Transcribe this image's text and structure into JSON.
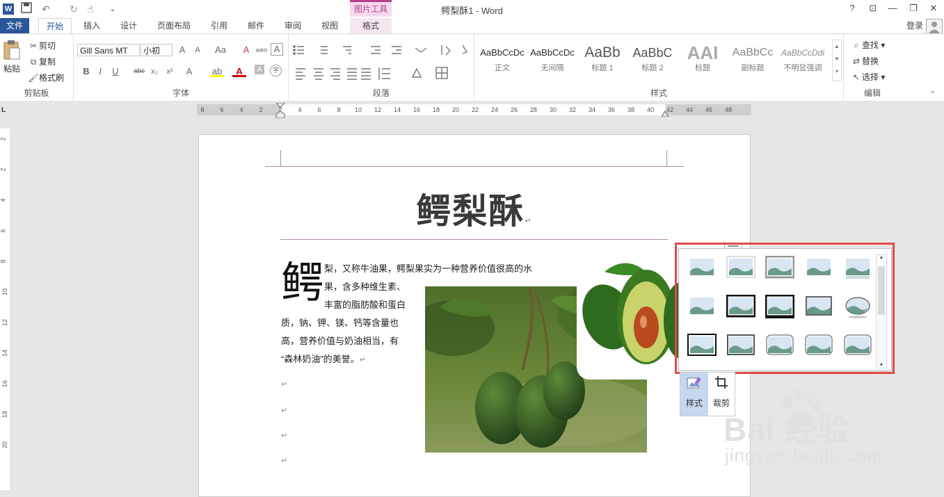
{
  "window": {
    "title": "鳄梨酥1 - Word",
    "contextual_tab_header": "图片工具",
    "help": "?",
    "restore_ribbon": "⊡",
    "minimize": "—",
    "maximize": "❐",
    "close": "✕"
  },
  "quick_access": {
    "word_icon": "W",
    "save": "💾",
    "undo": "↶",
    "redo": "↻",
    "touch": "☝",
    "customize": "⌄"
  },
  "tabs": [
    "文件",
    "开始",
    "插入",
    "设计",
    "页面布局",
    "引用",
    "邮件",
    "审阅",
    "视图",
    "格式"
  ],
  "account": {
    "login": "登录"
  },
  "ribbon": {
    "clipboard": {
      "label": "剪贴板",
      "paste": "粘贴",
      "cut": "剪切",
      "copy": "复制",
      "format_painter": "格式刷"
    },
    "font": {
      "label": "字体",
      "font_name": "Gill Sans MT",
      "font_size": "小初",
      "bold": "B",
      "italic": "I",
      "underline": "U",
      "strike": "abc",
      "subscript": "x₂",
      "superscript": "x²",
      "grow": "A",
      "shrink": "A",
      "case": "Aa",
      "clear": "A",
      "phonetic": "wén",
      "border": "A",
      "effect": "A",
      "highlight": "ab",
      "font_color": "A",
      "shading": "A",
      "enclose": "字"
    },
    "paragraph": {
      "label": "段落"
    },
    "styles": {
      "label": "样式",
      "items": [
        {
          "sample": "AaBbCcDc",
          "name": "正文"
        },
        {
          "sample": "AaBbCcDc",
          "name": "无间隔"
        },
        {
          "sample": "AaBb",
          "name": "标题 1"
        },
        {
          "sample": "AaBbC",
          "name": "标题 2"
        },
        {
          "sample": "AAI",
          "name": "标题"
        },
        {
          "sample": "AaBbCc",
          "name": "副标题"
        },
        {
          "sample": "AaBbCcDdi",
          "name": "不明显强调"
        }
      ]
    },
    "editing": {
      "label": "编辑",
      "find": "查找",
      "replace": "替换",
      "select": "选择"
    }
  },
  "ruler": {
    "horizontal": [
      "8",
      "6",
      "4",
      "2",
      "2",
      "4",
      "6",
      "8",
      "10",
      "12",
      "14",
      "16",
      "18",
      "20",
      "22",
      "24",
      "26",
      "28",
      "30",
      "32",
      "34",
      "36",
      "38",
      "40",
      "42",
      "44",
      "46",
      "48"
    ],
    "vertical": [
      "2",
      "2",
      "4",
      "6",
      "8",
      "10",
      "12",
      "14",
      "16",
      "18",
      "20"
    ],
    "tab_selector": "L"
  },
  "document": {
    "heading": "鳄梨酥",
    "dropcap": "鳄",
    "lines": [
      "梨，又称牛油果，鳄梨果实为一种营养价值很高的水",
      "果，含多种维生素、",
      "丰富的脂肪酸和蛋白",
      "质，钠、钾、镁、钙等含量也",
      "高，营养价值与奶油相当，有",
      "“森林奶油”的美誉。"
    ],
    "paragraph_mark": "↵"
  },
  "picture_tools": {
    "style_label": "样式",
    "crop_label": "裁剪"
  },
  "watermark": {
    "brand": "Bai 经验",
    "url": "jingyan.baidu.com"
  }
}
